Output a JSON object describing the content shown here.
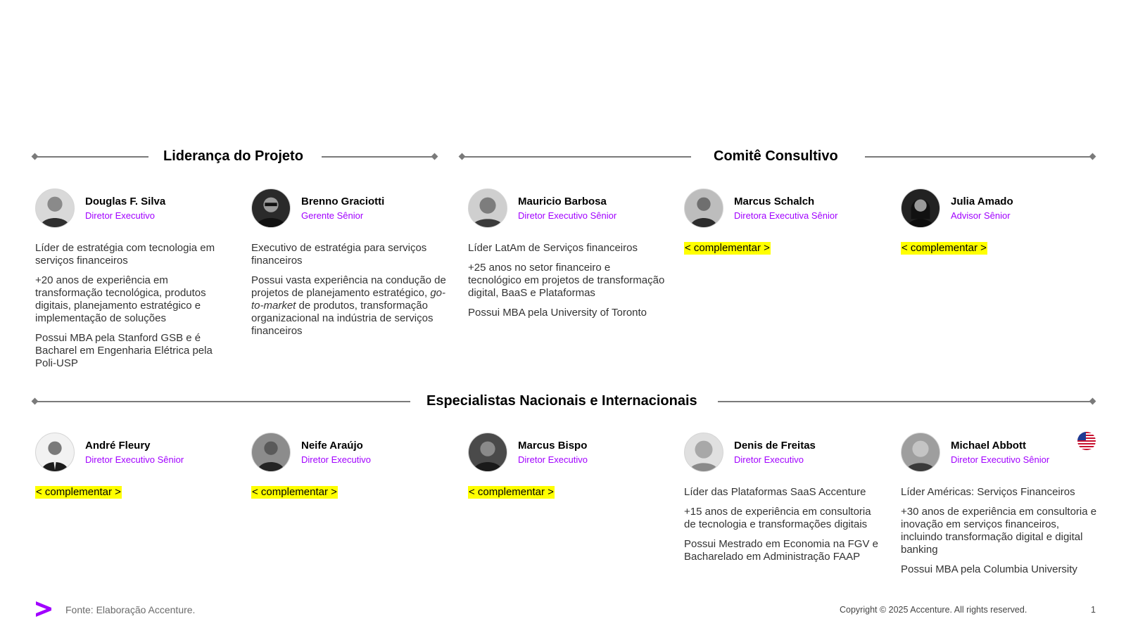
{
  "sections": {
    "leadership": "Liderança do Projeto",
    "committee": "Comitê Consultivo",
    "specialists": "Especialistas Nacionais e Internacionais"
  },
  "people_top": [
    {
      "name": "Douglas F. Silva",
      "role": "Diretor Executivo",
      "bio": [
        "Líder de estratégia com tecnologia em serviços financeiros",
        "+20 anos de experiência em transformação tecnológica, produtos digitais, planejamento estratégico e implementação de soluções",
        "Possui MBA pela Stanford GSB e é Bacharel em Engenharia Elétrica pela Poli-USP"
      ]
    },
    {
      "name": "Brenno Graciotti",
      "role": "Gerente Sênior",
      "bio": [
        "Executivo de estratégia para serviços financeiros"
      ],
      "bio2_before": "Possui vasta experiência na condução de projetos de planejamento estratégico, ",
      "bio2_italic": "go-to-market",
      "bio2_after": " de produtos, transformação organizacional na indústria de serviços financeiros"
    },
    {
      "name": "Mauricio Barbosa",
      "role": "Diretor Executivo Sênior",
      "bio": [
        "Líder LatAm de Serviços financeiros",
        "+25 anos no setor financeiro e tecnológico em projetos de transformação digital, BaaS e Plataformas",
        "Possui MBA pela University of Toronto"
      ]
    },
    {
      "name": "Marcus Schalch",
      "role": "Diretora Executiva Sênior",
      "placeholder": "< complementar >"
    },
    {
      "name": "Julia Amado",
      "role": "Advisor Sênior",
      "placeholder": "< complementar >"
    }
  ],
  "people_bottom": [
    {
      "name": "André Fleury",
      "role": "Diretor Executivo Sênior",
      "placeholder": "< complementar >"
    },
    {
      "name": "Neife Araújo",
      "role": "Diretor Executivo",
      "placeholder": "< complementar >"
    },
    {
      "name": "Marcus Bispo",
      "role": "Diretor Executivo",
      "placeholder": "< complementar >"
    },
    {
      "name": "Denis de Freitas",
      "role": "Diretor Executivo",
      "bio": [
        "Líder das Plataformas SaaS Accenture",
        "+15 anos de experiência em consultoria de tecnologia e transformações digitais",
        "Possui Mestrado em Economia na FGV e Bacharelado em Administração FAAP"
      ]
    },
    {
      "name": "Michael Abbott",
      "role": "Diretor Executivo Sênior",
      "bio": [
        "Líder Américas: Serviços Financeiros",
        "+30 anos de experiência em consultoria e inovação em serviços financeiros, incluindo transformação digital e digital banking",
        "Possui MBA pela Columbia University"
      ]
    }
  ],
  "footer": {
    "source": "Fonte: Elaboração Accenture.",
    "copyright": "Copyright © 2025 Accenture. All rights reserved.",
    "page": "1"
  },
  "colors": {
    "accent": "#a100ff",
    "highlight": "#ffff00",
    "rule": "#7a7a7a"
  },
  "icons": {
    "logo": "accenture-greater-than-logo",
    "flag": "us-flag-icon"
  }
}
